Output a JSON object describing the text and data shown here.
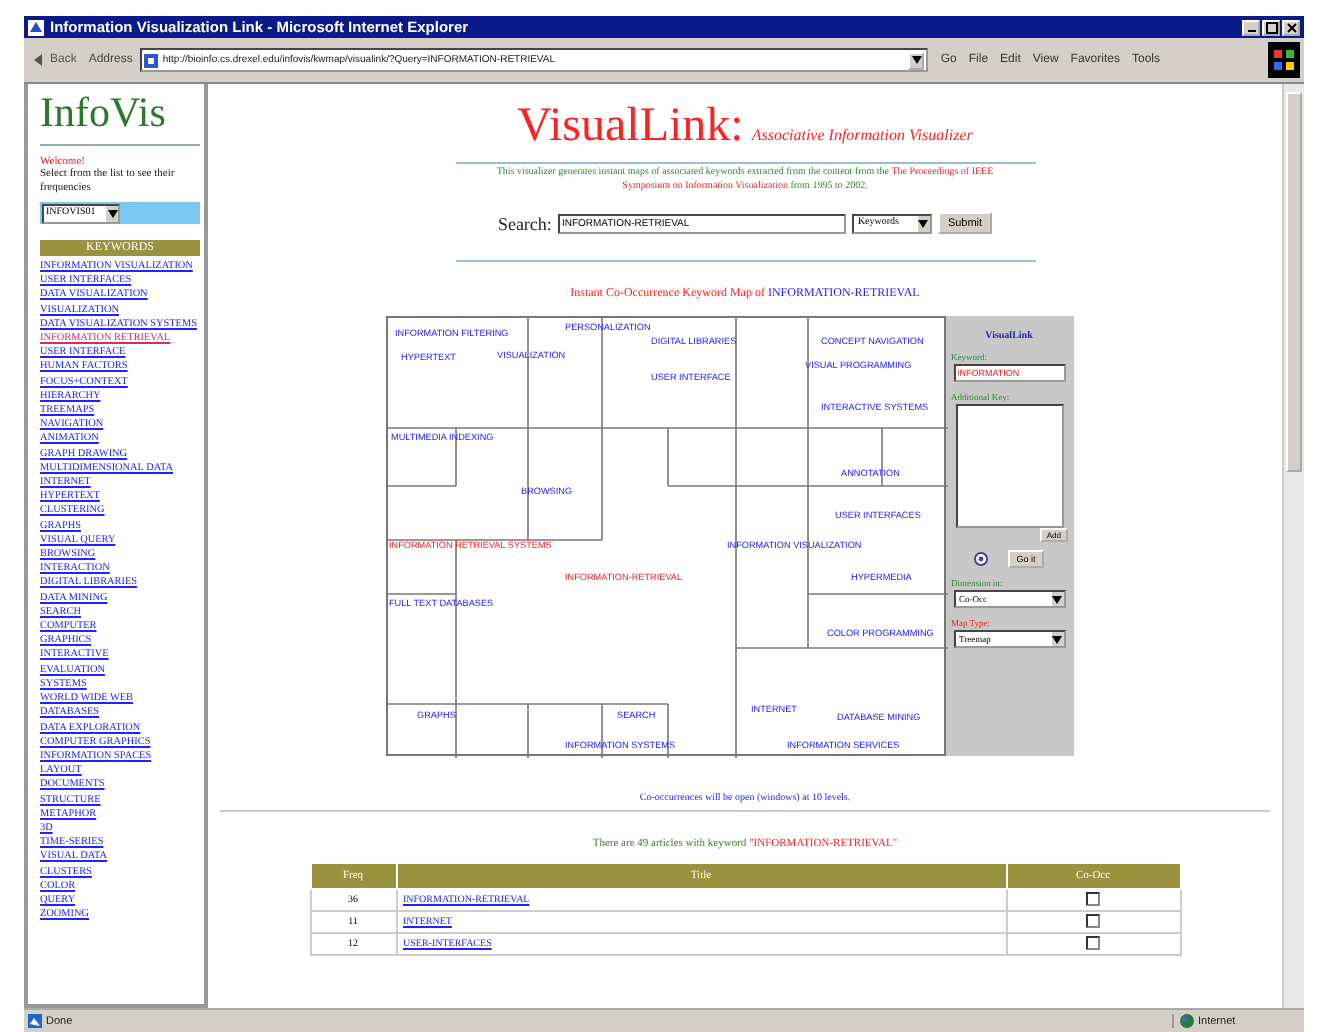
{
  "window": {
    "title": "Information Visualization Link - Microsoft Internet Explorer"
  },
  "toolbar": {
    "back": "Back",
    "address_label": "Address",
    "address": "http://bioinfo.cs.drexel.edu/infovis/kwmap/visualink/?Query=INFORMATION-RETRIEVAL",
    "go": "Go",
    "menu": [
      "File",
      "Edit",
      "View",
      "Favorites",
      "Tools"
    ]
  },
  "sidebar": {
    "logo": "InfoVis",
    "welcome": "Welcome!",
    "instruction": "Select from the list to see their frequencies",
    "dropdown": "INFOVIS01",
    "keywords_header": "KEYWORDS",
    "keywords": [
      {
        "label": "INFORMATION VISUALIZATION",
        "selected": false
      },
      {
        "label": "USER INTERFACES",
        "selected": false
      },
      {
        "label": "DATA VISUALIZATION",
        "selected": false
      },
      {
        "label": "VISUALIZATION",
        "selected": false
      },
      {
        "label": "DATA VISUALIZATION SYSTEMS",
        "selected": false
      },
      {
        "label": "INFORMATION RETRIEVAL",
        "selected": true
      },
      {
        "label": "USER INTERFACE",
        "selected": false
      },
      {
        "label": "HUMAN FACTORS",
        "selected": false
      },
      {
        "label": "FOCUS+CONTEXT",
        "selected": false
      },
      {
        "label": "HIERARCHY",
        "selected": false
      },
      {
        "label": "TREEMAPS",
        "selected": false
      },
      {
        "label": "NAVIGATION",
        "selected": false
      },
      {
        "label": "ANIMATION",
        "selected": false
      },
      {
        "label": "GRAPH DRAWING",
        "selected": false
      },
      {
        "label": "MULTIDIMENSIONAL DATA",
        "selected": false
      },
      {
        "label": "INTERNET",
        "selected": false
      },
      {
        "label": "HYPERTEXT",
        "selected": false
      },
      {
        "label": "CLUSTERING",
        "selected": false
      },
      {
        "label": "GRAPHS",
        "selected": false
      },
      {
        "label": "VISUAL QUERY",
        "selected": false
      },
      {
        "label": "BROWSING",
        "selected": false
      },
      {
        "label": "INTERACTION",
        "selected": false
      },
      {
        "label": "DIGITAL LIBRARIES",
        "selected": false
      },
      {
        "label": "DATA MINING",
        "selected": false
      },
      {
        "label": "SEARCH",
        "selected": false
      },
      {
        "label": "COMPUTER",
        "selected": false
      },
      {
        "label": "GRAPHICS",
        "selected": false
      },
      {
        "label": "INTERACTIVE",
        "selected": false
      },
      {
        "label": "EVALUATION",
        "selected": false
      },
      {
        "label": "SYSTEMS",
        "selected": false
      },
      {
        "label": "WORLD WIDE WEB",
        "selected": false
      },
      {
        "label": "DATABASES",
        "selected": false
      },
      {
        "label": "DATA EXPLORATION",
        "selected": false
      },
      {
        "label": "COMPUTER GRAPHICS",
        "selected": false
      },
      {
        "label": "INFORMATION SPACES",
        "selected": false
      },
      {
        "label": "LAYOUT",
        "selected": false
      },
      {
        "label": "DOCUMENTS",
        "selected": false
      },
      {
        "label": "STRUCTURE",
        "selected": false
      },
      {
        "label": "METAPHOR",
        "selected": false
      },
      {
        "label": "3D",
        "selected": false
      },
      {
        "label": "TIME-SERIES",
        "selected": false
      },
      {
        "label": "VISUAL DATA",
        "selected": false
      },
      {
        "label": "CLUSTERS",
        "selected": false
      },
      {
        "label": "COLOR",
        "selected": false
      },
      {
        "label": "QUERY",
        "selected": false
      },
      {
        "label": "ZOOMING",
        "selected": false
      }
    ]
  },
  "header": {
    "title": "VisualLink:",
    "subtitle": "Associative Information Visualizer",
    "intro": [
      {
        "text": "This visualizer generates instant maps of associated keywords extracted from the content",
        "highlighted": false
      },
      {
        "text": " from the ",
        "highlighted": false
      },
      {
        "text": "The Proceedings of IEEE Symposium on Information Visualization",
        "highlighted": true
      },
      {
        "text": " from 1995 to 2002.",
        "highlighted": false
      }
    ]
  },
  "search": {
    "label": "Search:",
    "value": "INFORMATION-RETRIEVAL",
    "scope": "Keywords",
    "button": "Submit"
  },
  "map": {
    "title": "Instant Co-Occurrence Keyword Map of ",
    "keyword": "INFORMATION-RETRIEVAL",
    "labels": [
      {
        "text": "INFORMATION FILTERING",
        "highlighted": false
      },
      {
        "text": "HYPERTEXT",
        "highlighted": false
      },
      {
        "text": "PERSONALIZATION",
        "highlighted": false
      },
      {
        "text": "VISUALIZATION",
        "highlighted": false
      },
      {
        "text": "DIGITAL LIBRARIES",
        "highlighted": false
      },
      {
        "text": "CONCEPT NAVIGATION",
        "highlighted": false
      },
      {
        "text": "USER INTERFACE",
        "highlighted": false
      },
      {
        "text": "VISUAL PROGRAMMING",
        "highlighted": false
      },
      {
        "text": "INTERACTIVE SYSTEMS",
        "highlighted": false
      },
      {
        "text": "MULTIMEDIA INDEXING",
        "highlighted": false
      },
      {
        "text": "BROWSING",
        "highlighted": false
      },
      {
        "text": "ANNOTATION",
        "highlighted": false
      },
      {
        "text": "USER INTERFACES",
        "highlighted": false
      },
      {
        "text": "INFORMATION RETRIEVAL SYSTEMS",
        "highlighted": true
      },
      {
        "text": "INFORMATION VISUALIZATION",
        "highlighted": false
      },
      {
        "text": "INFORMATION-RETRIEVAL",
        "highlighted": true
      },
      {
        "text": "HYPERMEDIA",
        "highlighted": false
      },
      {
        "text": "FULL TEXT DATABASES",
        "highlighted": false
      },
      {
        "text": "COLOR PROGRAMMING",
        "highlighted": false
      },
      {
        "text": "GRAPHS",
        "highlighted": false
      },
      {
        "text": "SEARCH",
        "highlighted": false
      },
      {
        "text": "INTERNET",
        "highlighted": false
      },
      {
        "text": "DATABASE MINING",
        "highlighted": false
      },
      {
        "text": "INFORMATION SYSTEMS",
        "highlighted": false
      },
      {
        "text": "INFORMATION SERVICES",
        "highlighted": false
      }
    ]
  },
  "panel": {
    "title": "VisualLink",
    "keyword_label": "Keyword:",
    "keyword": "INFORMATION",
    "additional_label": "Additional Key:",
    "add_button": "Add",
    "go_button": "Go it",
    "dimension_label": "Dimension in:",
    "dimension": "Co-Occ",
    "maptype_label": "Map Type:",
    "maptype": "Treemap"
  },
  "notice": "Co-occurrences will be open (windows) at 10 levels.",
  "results": {
    "summary": "There are 49 articles with keyword ",
    "keyword": "\"INFORMATION-RETRIEVAL\"",
    "columns": [
      "Freq",
      "Title",
      "Co-Occ"
    ],
    "rows": [
      {
        "freq": "36",
        "title": "INFORMATION-RETRIEVAL",
        "checked": false
      },
      {
        "freq": "11",
        "title": "INTERNET",
        "checked": false
      },
      {
        "freq": "12",
        "title": "USER-INTERFACES",
        "checked": false
      }
    ]
  },
  "status_bar": {
    "text": "Done",
    "zone": "Internet"
  }
}
